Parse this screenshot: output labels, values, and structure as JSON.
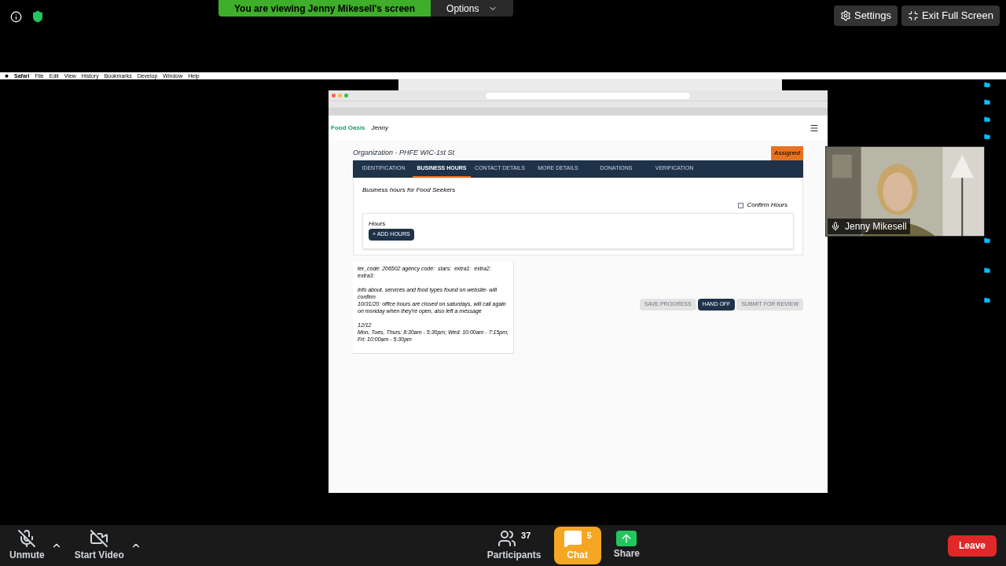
{
  "meeting_top": {
    "viewing_banner": "You are viewing Jenny Mikesell's screen",
    "options_label": "Options",
    "settings_label": "Settings",
    "exit_label": "Exit Full Screen"
  },
  "mac_menubar": {
    "app": "Safari",
    "items": [
      "File",
      "Edit",
      "View",
      "History",
      "Bookmarks",
      "Develop",
      "Window",
      "Help"
    ]
  },
  "app": {
    "brand": "Food Oasis",
    "user": "Jenny",
    "organization": "Organization - PHFE WIC-1st St",
    "status_badge": "Assigned",
    "tabs": [
      {
        "label": "IDENTIFICATION",
        "selected": false
      },
      {
        "label": "BUSINESS HOURS",
        "selected": true
      },
      {
        "label": "CONTACT DETAILS",
        "selected": false
      },
      {
        "label": "MORE DETAILS",
        "selected": false
      },
      {
        "label": "DONATIONS",
        "selected": false
      },
      {
        "label": "VERIFICATION",
        "selected": false
      }
    ],
    "section_title": "Business hours for Food Seekers",
    "confirm": {
      "label": "Confirm Hours",
      "checked": false
    },
    "hours_label": "Hours",
    "add_hours": "+ ADD HOURS",
    "notes": {
      "text": "ter_code: 206502 agency code:  stars:  extra1:  extra2:  extra3:\n\ninfo about. services and food types found on website- will confirm\n10/31/20: office hours are closed on saturdays, will call again on monday when they're open, also left a message\n\n12/12\nMon, Tues, Thurs: 8:30am - 5:30pm; Wed: 10:00am - 7:15pm; Fri: 10:00am - 5:30pm"
    },
    "actions": [
      {
        "label": "SAVE PROGRESS",
        "disabled": true
      },
      {
        "label": "HAND OFF",
        "disabled": false
      },
      {
        "label": "SUBMIT FOR REVIEW",
        "disabled": true
      }
    ]
  },
  "video": {
    "name": "Jenny Mikesell"
  },
  "toolbar": {
    "left": [
      {
        "label": "Unmute",
        "kind": "mic",
        "off": true
      },
      {
        "label": "Start Video",
        "kind": "video",
        "off": true
      }
    ],
    "center": [
      {
        "label": "Participants",
        "kind": "participants",
        "count": "37",
        "selected": false
      },
      {
        "label": "Chat",
        "kind": "chat",
        "count": "5",
        "selected": true
      },
      {
        "label": "Share",
        "kind": "share",
        "selected": false
      }
    ],
    "leave": "Leave"
  }
}
